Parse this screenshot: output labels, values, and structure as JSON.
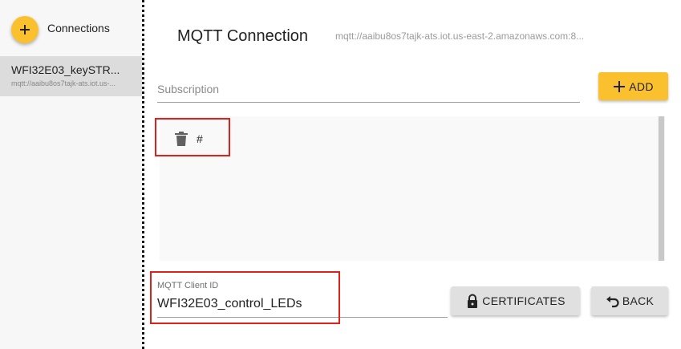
{
  "sidebar": {
    "add_icon": "plus-icon",
    "connections_label": "Connections",
    "items": [
      {
        "name": "WFI32E03_keySTR...",
        "url": "mqtt://aaibu8os7tajk-ats.iot.us-..."
      }
    ]
  },
  "header": {
    "title": "MQTT Connection",
    "url": "mqtt://aaibu8os7tajk-ats.iot.us-east-2.amazonaws.com:8..."
  },
  "subscription": {
    "placeholder": "Subscription",
    "add_label": "ADD",
    "topics": [
      {
        "topic": "#",
        "icon": "trash-icon"
      }
    ]
  },
  "client": {
    "label": "MQTT Client ID",
    "value": "WFI32E03_control_LEDs"
  },
  "actions": {
    "certificates_label": "CERTIFICATES",
    "back_label": "BACK"
  },
  "colors": {
    "accent": "#fbc02d",
    "highlight": "#e0201b",
    "button_gray": "#e0e0e0"
  }
}
